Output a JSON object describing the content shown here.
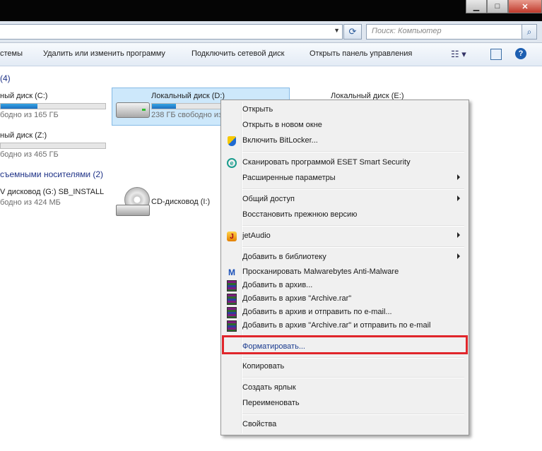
{
  "window": {
    "minimize_icon": "minimize-icon",
    "maximize_icon": "maximize-icon",
    "close_icon": "close-icon",
    "minimize": "▁",
    "maximize": "□",
    "close": "✕"
  },
  "address": {
    "value": "",
    "dropdown": "▼",
    "refresh": "⟳"
  },
  "search": {
    "placeholder": "Поиск: Компьютер",
    "icon": "⌕"
  },
  "toolbar": {
    "item1": "стемы",
    "item2": "Удалить или изменить программу",
    "item3": "Подключить сетевой диск",
    "item4": "Открыть панель управления",
    "view_icon": "☷ ▾",
    "help": "?"
  },
  "groups": {
    "hdd_header": "(4)",
    "removable_header": "съемными носителями (2)"
  },
  "drives": {
    "c": {
      "name": "ный диск (C:)",
      "free": "бодно из 165 ГБ",
      "used_fraction": 0.35
    },
    "d": {
      "name": "Локальный диск (D:)",
      "free": "238 ГБ свободно из",
      "used_fraction": 0.35
    },
    "e": {
      "name": "Локальный диск (E:)"
    },
    "z": {
      "name": "ный диск (Z:)",
      "free": "бодно из 465 ГБ",
      "used_fraction": 0.0
    },
    "g": {
      "name": "V дисковод (G:) SB_INSTALL",
      "free": "бодно из 424 МБ"
    },
    "i": {
      "name": "CD-дисковод (I:)"
    }
  },
  "context_menu": {
    "open": "Открыть",
    "open_new_window": "Открыть в новом окне",
    "bitlocker": "Включить BitLocker...",
    "eset": "Сканировать программой ESET Smart Security",
    "eset_icon": "e",
    "advanced": "Расширенные параметры",
    "share": "Общий доступ",
    "restore": "Восстановить прежнюю версию",
    "jetaudio": "jetAudio",
    "jetaudio_icon": "J",
    "library": "Добавить в библиотеку",
    "malwarebytes": "Просканировать Malwarebytes Anti-Malware",
    "malwarebytes_icon": "M",
    "add_archive": "Добавить в архив...",
    "add_archive_rar": "Добавить в архив \"Archive.rar\"",
    "add_email": "Добавить в архив и отправить по e-mail...",
    "add_rar_email": "Добавить в архив \"Archive.rar\" и отправить по e-mail",
    "format": "Форматировать...",
    "copy": "Копировать",
    "shortcut": "Создать ярлык",
    "rename": "Переименовать",
    "properties": "Свойства"
  },
  "colors": {
    "highlight": "#e0262b",
    "group_header": "#1e3287",
    "selected_tile": "#cde8fb"
  }
}
